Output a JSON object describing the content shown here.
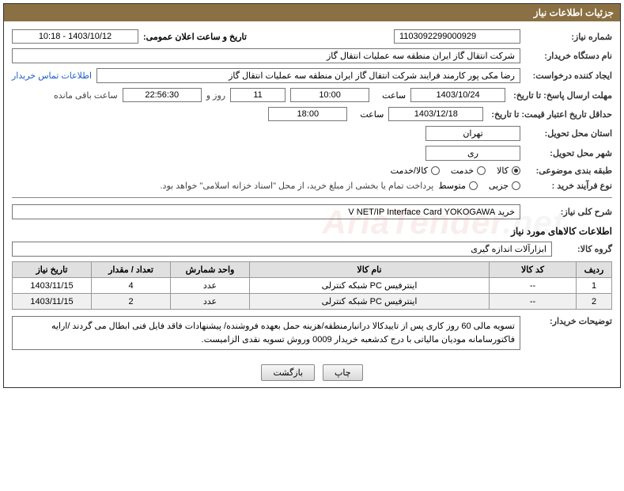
{
  "panel_title": "جزئیات اطلاعات نیاز",
  "fields": {
    "need_number_label": "شماره نیاز:",
    "need_number": "1103092299000929",
    "public_announce_label": "تاریخ و ساعت اعلان عمومی:",
    "public_announce": "1403/10/12 - 10:18",
    "buyer_org_label": "نام دستگاه خریدار:",
    "buyer_org": "شرکت انتقال گاز ایران منطقه سه عملیات انتقال گاز",
    "requester_label": "ایجاد کننده درخواست:",
    "requester": "رضا مکی پور کارمند فرایند شرکت انتقال گاز ایران منطقه سه عملیات انتقال گاز",
    "buyer_contact": "اطلاعات تماس خریدار",
    "deadline_reply_label": "مهلت ارسال پاسخ: تا تاریخ:",
    "deadline_date": "1403/10/24",
    "time_label": "ساعت",
    "deadline_time": "10:00",
    "days": "11",
    "days_and": "روز و",
    "remaining_time": "22:56:30",
    "remaining_suffix": "ساعت باقی مانده",
    "price_validity_label": "حداقل تاریخ اعتبار قیمت: تا تاریخ:",
    "price_validity_date": "1403/12/18",
    "price_validity_time": "18:00",
    "province_label": "استان محل تحویل:",
    "province": "تهران",
    "city_label": "شهر محل تحویل:",
    "city": "ری",
    "class_label": "طبقه بندی موضوعی:",
    "class_opts": [
      "کالا",
      "خدمت",
      "کالا/خدمت"
    ],
    "class_selected": 0,
    "purchase_type_label": "نوع فرآیند خرید :",
    "purchase_opts": [
      "جزیی",
      "متوسط"
    ],
    "purchase_note": "پرداخت تمام یا بخشی از مبلغ خرید، از محل \"اسناد خزانه اسلامی\" خواهد بود.",
    "summary_label": "شرح کلی نیاز:",
    "summary": "خرید V NET/IP Interface Card YOKOGAWA",
    "items_section": "اطلاعات کالاهای مورد نیاز",
    "group_label": "گروه کالا:",
    "group": "ابزارآلات اندازه گیری",
    "headers": {
      "row": "ردیف",
      "code": "کد کالا",
      "name": "نام کالا",
      "unit": "واحد شمارش",
      "qty": "تعداد / مقدار",
      "need_date": "تاریخ نیاز"
    },
    "rows": [
      {
        "row": "1",
        "code": "--",
        "name": "اینترفیس PC شبکه کنترلی",
        "unit": "عدد",
        "qty": "4",
        "need_date": "1403/11/15"
      },
      {
        "row": "2",
        "code": "--",
        "name": "اینترفیس PC شبکه کنترلی",
        "unit": "عدد",
        "qty": "2",
        "need_date": "1403/11/15"
      }
    ],
    "explain_label": "توضیحات خریدار:",
    "explain": "تسویه مالی 60 روز کاری پس از تاییدکالا درانبارمنطقه/هزینه حمل بعهده فروشنده/ پیشنهادات فاقد فایل فنی ابطال می گردند /ارایه فاکتورسامانه مودیان مالیاتی با درج کدشعبه خریدار 0009 وروش تسویه نقدی الزامیست.",
    "btn_print": "چاپ",
    "btn_back": "بازگشت"
  },
  "watermark": {
    "a": "AriaTender",
    "b": ".net"
  }
}
